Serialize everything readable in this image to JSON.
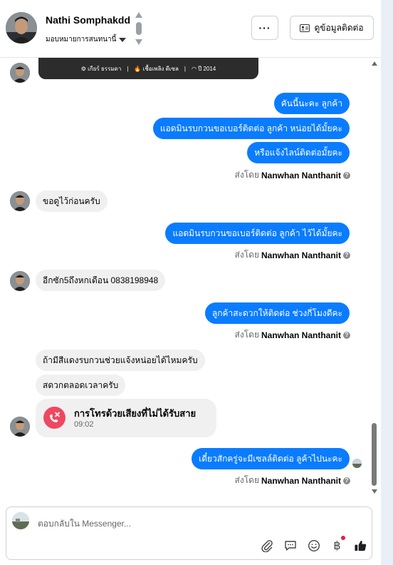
{
  "header": {
    "contact_name": "Nathi Somphakdd",
    "assign_label": "มอบหมายการสนทนานี้",
    "more_label": "···",
    "contact_info_label": "ดูข้อมูลติดต่อ"
  },
  "card": {
    "items": [
      "⚙ เกียร์ ธรรมดา",
      "|",
      "🔥 เชื้อเพลิง ดีเซล",
      "|",
      "◠ ปี 2014"
    ]
  },
  "messages": {
    "m1": "คันนี้นะคะ  ลูกค้า",
    "m2": "แอดมินรบกวนขอเบอร์ติดต่อ ลูกค้า หน่อยได้มั้ยคะ",
    "m3": "หรือแจ้งไลน์ติดต่อมั้ยคะ",
    "m4": "ขอดูไว้ก่อนครับ",
    "m5": "แอดมินรบกวนขอเบอร์ติดต่อ ลูกค้า ไว้ได้มั้ยคะ",
    "m6": "อีกซัก5ถึงหกเดือน  0838198948",
    "m7": "ลูกค้าสะดวกให้ติดต่อ ช่วงกี่โมงดีคะ",
    "m8": "ถ้ามีสีแดงรบกวนช่วยแจ้งหน่อยได้ไหมครับ",
    "m9": "สดวกตลอดเวลาครับ",
    "m10": "เดี๋ยวสักครู่จะมีเซลล์ติดต่อ ลูค้าไปนะคะ"
  },
  "sent_by": {
    "prefix": "ส่งโดย",
    "agent": "Nanwhan Nanthanit"
  },
  "call": {
    "title": "การโทรด้วยเสียงที่ไม่ได้รับสาย",
    "time": "09:02"
  },
  "composer": {
    "placeholder": "ตอบกลับใน Messenger...",
    "baht_symbol": "฿"
  },
  "colors": {
    "outgoing_bubble": "#0a7cff",
    "incoming_bubble": "#f0f0f0",
    "missed_call": "#ef4861"
  }
}
